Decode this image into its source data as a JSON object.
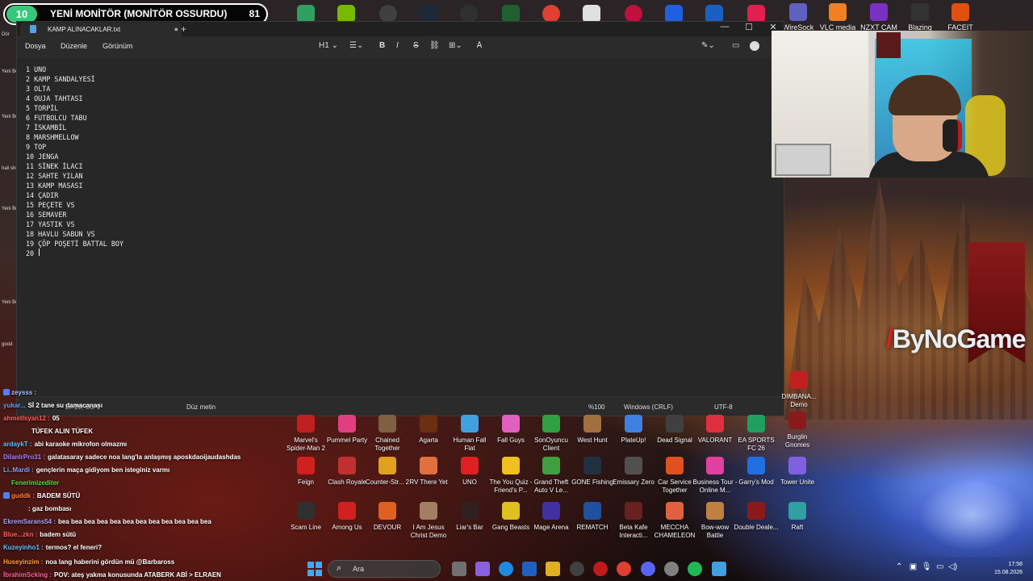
{
  "poll": {
    "number": "10",
    "text": "YENİ MONİTÖR (MONİTÖR OSSURDU)",
    "votes": "81"
  },
  "top_apps": [
    {
      "label": "WireSock",
      "color": "#6060c0"
    },
    {
      "label": "VLC media",
      "color": "#f08020"
    },
    {
      "label": "NZXT CAM",
      "color": "#7a30c0"
    },
    {
      "label": "Blazing Sails",
      "color": "#333333"
    },
    {
      "label": "FACEIT",
      "color": "#e05010"
    }
  ],
  "notepad": {
    "tab_title": "KAMP ALINACAKLAR.txt",
    "menus": [
      "Dosya",
      "Düzenle",
      "Görünüm"
    ],
    "heading_format": "H1",
    "lines": [
      "1 UNO",
      "2 KAMP SANDALYESİ",
      "3 OLTA",
      "4 OUJA TAHTASI",
      "5 TORPİL",
      "6 FUTBOLCU TABU",
      "7 İSKAMBİL",
      "8 MARSHMELLOW",
      "9 TOP",
      "10 JENGA",
      "11 SİNEK İLACI",
      "12 SAHTE YILAN",
      "13 KAMP MASASI",
      "14 ÇADIR",
      "15 PEÇETE VS",
      "16 SEMAVER",
      "17 YASTIK VS",
      "18 HAVLU SABUN VS",
      "19 ÇÖP POŞETİ BATTAL BOY",
      "20"
    ],
    "status": {
      "position": "Ln 20, Col 1",
      "mode": "Düz metin",
      "zoom": "%100",
      "eol": "Windows (CRLF)",
      "encoding": "UTF-8"
    }
  },
  "brand_watermark": "ByNoGame",
  "desktop_icons": [
    {
      "label": "Marvel's Spider-Man 2",
      "color": "#c02020"
    },
    {
      "label": "Pummel Party",
      "color": "#e04080"
    },
    {
      "label": "Chained Together",
      "color": "#806040"
    },
    {
      "label": "Agarta",
      "color": "#6a3010"
    },
    {
      "label": "Human Fall Flat",
      "color": "#40a0e0"
    },
    {
      "label": "Fall Guys",
      "color": "#e060c0"
    },
    {
      "label": "SonOyuncu Client",
      "color": "#30a040"
    },
    {
      "label": "West Hunt",
      "color": "#a07040"
    },
    {
      "label": "PlateUp!",
      "color": "#4080e0"
    },
    {
      "label": "Dead Signal",
      "color": "#404040"
    },
    {
      "label": "VALORANT",
      "color": "#e03040"
    },
    {
      "label": "EA SPORTS FC 26",
      "color": "#20a060"
    },
    {
      "label": "Feign",
      "color": "#d02020"
    },
    {
      "label": "Clash Royale",
      "color": "#c03030"
    },
    {
      "label": "Counter-Str... 2",
      "color": "#e0a020"
    },
    {
      "label": "RV There Yet",
      "color": "#e07040"
    },
    {
      "label": "UNO",
      "color": "#e02020"
    },
    {
      "label": "The You Quiz - Friend's P...",
      "color": "#f0c020"
    },
    {
      "label": "Grand Theft Auto V Le...",
      "color": "#40a040"
    },
    {
      "label": "GONE Fishing",
      "color": "#203040"
    },
    {
      "label": "Emissary Zero",
      "color": "#505050"
    },
    {
      "label": "Car Service Together",
      "color": "#e05020"
    },
    {
      "label": "Business Tour - Online M...",
      "color": "#e040a0"
    },
    {
      "label": "Garry's Mod",
      "color": "#2070e0"
    },
    {
      "label": "Tower Unite",
      "color": "#8060e0"
    },
    {
      "label": "Scam Line",
      "color": "#303030"
    },
    {
      "label": "Among Us",
      "color": "#d02020"
    },
    {
      "label": "DEVOUR",
      "color": "#e06020"
    },
    {
      "label": "I Am Jesus Christ Demo",
      "color": "#a08060"
    },
    {
      "label": "Liar's Bar",
      "color": "#302020"
    },
    {
      "label": "Gang Beasts",
      "color": "#e0c020"
    },
    {
      "label": "Mage Arena",
      "color": "#4030a0"
    },
    {
      "label": "REMATCH",
      "color": "#2050a0"
    },
    {
      "label": "Beta Kafe Interacti...",
      "color": "#6a2020"
    },
    {
      "label": "MECCHA CHAMELEON",
      "color": "#e06040"
    },
    {
      "label": "Bow-wow Battle",
      "color": "#c08040"
    },
    {
      "label": "Double Deale...",
      "color": "#8a1a1a"
    },
    {
      "label": "Raft",
      "color": "#30a0a0"
    }
  ],
  "right_icons": [
    {
      "label": "DIMBANA... Demo",
      "color": "#c02020"
    },
    {
      "label": "Burglin Gnomes",
      "color": "#8a1a1a"
    }
  ],
  "chat": [
    {
      "user": "zeysss :",
      "msg": "",
      "color": "#a0c0ff"
    },
    {
      "user": "yukar...",
      "msg": "Sİ 2 tane su damacanası",
      "color": "#60a0ff"
    },
    {
      "user": "ahmetlsyan12 :",
      "msg": "05",
      "color": "#ff6060"
    },
    {
      "user": "",
      "msg": "TÜFEK ALIN TÜFEK",
      "color": "#ffffff"
    },
    {
      "user": "ardaykT :",
      "msg": "abi karaoke mikrofon olmazmı",
      "color": "#60c0ff"
    },
    {
      "user": "DilanlrPro31 :",
      "msg": "galatasaray sadece noa lang'la anlaşmış aposkdaoijaudashdas",
      "color": "#a080ff"
    },
    {
      "user": "Li..Mardi :",
      "msg": "gençlerin maça gidiyom ben isteginiz varmı",
      "color": "#80a0ff"
    },
    {
      "user": "Fenerimizediter",
      "msg": "",
      "color": "#40e040"
    },
    {
      "user": "guddk :",
      "msg": "BADEM SÜTÜ",
      "color": "#ff8040"
    },
    {
      "user": "",
      "msg": ": gaz bombası",
      "color": "#ffffff"
    },
    {
      "user": "EkremSarans54 :",
      "msg": "bea bea bea bea bea bea bea bea bea bea bea bea",
      "color": "#a0a0ff"
    },
    {
      "user": "Blue...zkn :",
      "msg": "badem sütü",
      "color": "#ff6060"
    },
    {
      "user": "Kuzeyinho1 :",
      "msg": "termos? el feneri?",
      "color": "#60c0ff"
    },
    {
      "user": "Huseyinzim :",
      "msg": "noa lang haberini gördün mü @Barbaross",
      "color": "#ffa040"
    },
    {
      "user": "İbrahimScking :",
      "msg": "POV: ateş yakma konusunda ATABERK ABİ > ELRAEN",
      "color": "#ff60a0"
    }
  ],
  "left_edge": [
    "Dör",
    "Yeni Belg",
    "Yeni Belg",
    "hali shor",
    "Yeni Belg",
    "Yeni Belg",
    "good"
  ],
  "taskbar": {
    "search_placeholder": "Ara",
    "time": "17:58",
    "date": "15.08.2026"
  }
}
